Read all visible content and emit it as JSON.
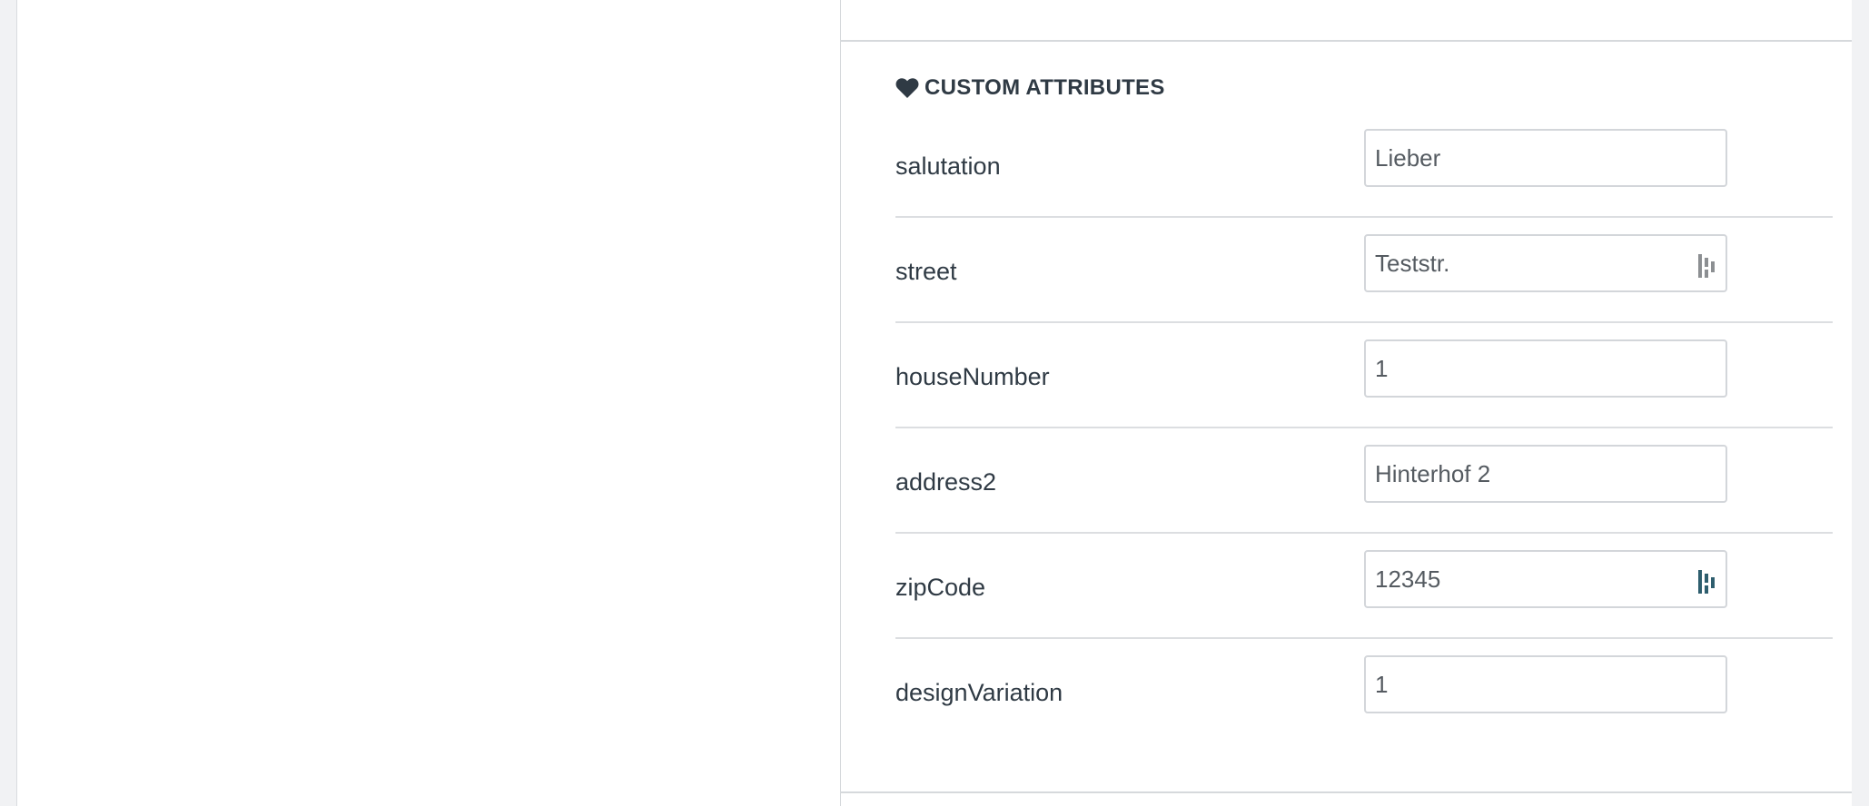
{
  "section": {
    "title": "CUSTOM ATTRIBUTES",
    "icon": "heart-icon"
  },
  "attributes": [
    {
      "label": "salutation",
      "value": "Lieber",
      "badge": null
    },
    {
      "label": "street",
      "value": "Teststr.",
      "badge": "grey"
    },
    {
      "label": "houseNumber",
      "value": "1",
      "badge": null
    },
    {
      "label": "address2",
      "value": "Hinterhof 2",
      "badge": null
    },
    {
      "label": "zipCode",
      "value": "12345",
      "badge": "teal"
    },
    {
      "label": "designVariation",
      "value": "1",
      "badge": null
    }
  ],
  "colors": {
    "text": "#2f3a44",
    "border": "#d3d6da",
    "badge_grey": "#8c8f92",
    "badge_teal": "#2e5e6e"
  }
}
